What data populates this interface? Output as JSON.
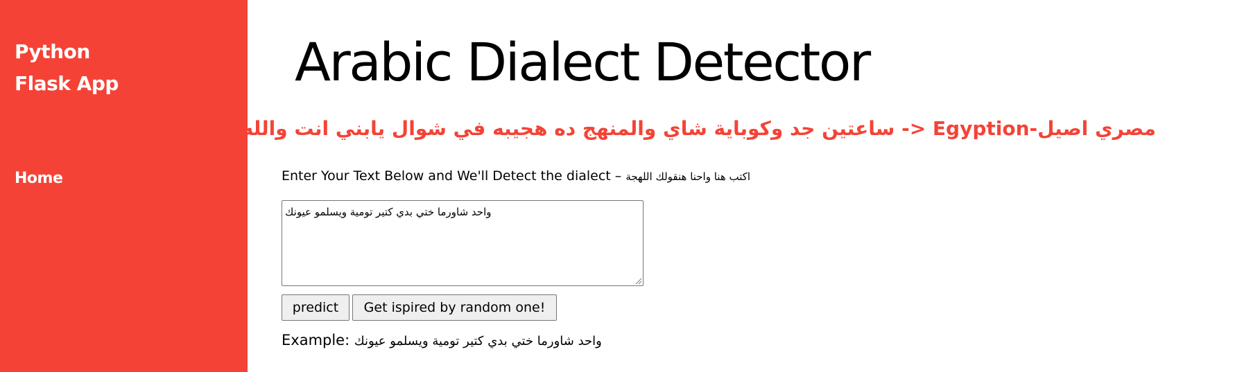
{
  "sidebar": {
    "brand_line1": "Python",
    "brand_line2": "Flask App",
    "nav": [
      {
        "label": "Home"
      }
    ]
  },
  "main": {
    "title": "Arabic Dialect Detector",
    "highlight": "مصري اصيل-Egyption <- ساعتين جد وكوباية شاي والمنهج ده هجيبه في شوال يابني انت والله متقلقش!",
    "intro_en": "Enter Your Text Below and We'll Detect the dialect – ",
    "intro_ar": "اكتب هنا واحنا هنقولك اللهجة",
    "input_value": "واحد شاورما ختي بدي كتير تومية ويسلمو عيونك",
    "buttons": {
      "predict": "predict",
      "random": "Get ispired by random one!"
    },
    "example_label": "Example: ",
    "example_text": "واحد شاورما ختي بدي كتير تومية ويسلمو عيونك"
  },
  "colors": {
    "accent": "#f44336",
    "button_bg": "#efefef",
    "border": "#767676"
  }
}
